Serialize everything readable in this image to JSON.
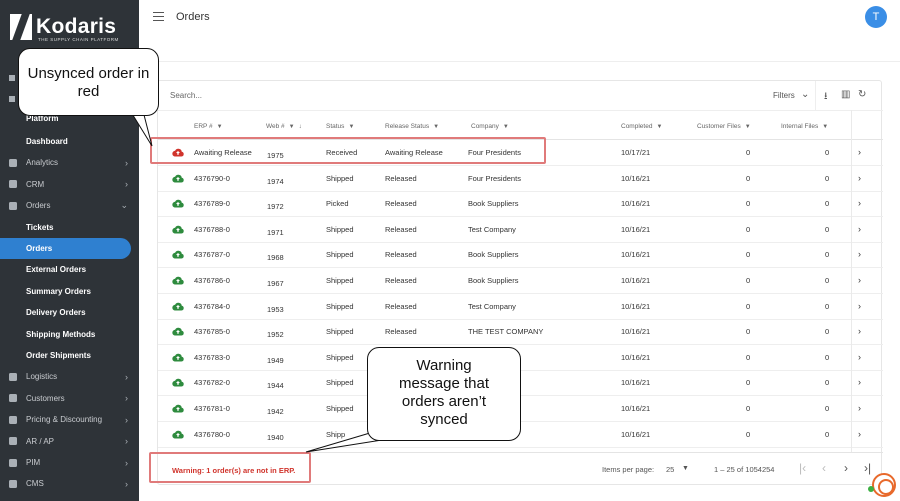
{
  "app": {
    "logo_text": "Kodaris",
    "logo_tagline": "THE SUPPLY CHAIN PLATFORM",
    "page_title": "Orders",
    "user_initial": "T"
  },
  "sidebar": {
    "partial_label": "Platform",
    "items": [
      {
        "label": "Dashboard",
        "type": "sub"
      },
      {
        "label": "Analytics",
        "type": "main",
        "icon": "analytics-icon"
      },
      {
        "label": "CRM",
        "type": "main",
        "icon": "crm-icon"
      },
      {
        "label": "Orders",
        "type": "main",
        "icon": "orders-icon"
      },
      {
        "label": "Tickets",
        "type": "sub"
      },
      {
        "label": "Orders",
        "type": "sub",
        "active": true
      },
      {
        "label": "External Orders",
        "type": "sub"
      },
      {
        "label": "Summary Orders",
        "type": "sub"
      },
      {
        "label": "Delivery Orders",
        "type": "sub"
      },
      {
        "label": "Shipping Methods",
        "type": "sub"
      },
      {
        "label": "Order Shipments",
        "type": "sub"
      },
      {
        "label": "Logistics",
        "type": "main",
        "icon": "truck-icon"
      },
      {
        "label": "Customers",
        "type": "main",
        "icon": "customers-icon"
      },
      {
        "label": "Pricing & Discounting",
        "type": "main",
        "icon": "dollar-icon"
      },
      {
        "label": "AR / AP",
        "type": "main",
        "icon": "bank-icon"
      },
      {
        "label": "PIM",
        "type": "main",
        "icon": "tag-icon"
      },
      {
        "label": "CMS",
        "type": "main",
        "icon": "cms-icon"
      }
    ]
  },
  "toolbar": {
    "search_placeholder": "Search...",
    "filters_label": "Filters"
  },
  "table": {
    "columns": [
      "ERP #",
      "Web #",
      "Status",
      "Release Status",
      "Company",
      "Completed",
      "Customer Files",
      "Internal Files"
    ],
    "rows": [
      {
        "erp": "Awaiting Release",
        "web": "1975",
        "status": "Received",
        "release": "Awaiting Release",
        "company": "Four Presidents",
        "completed": "10/17/21",
        "customer_files": "0",
        "internal_files": "0",
        "synced": false
      },
      {
        "erp": "4376790-0",
        "web": "1974",
        "status": "Shipped",
        "release": "Released",
        "company": "Four Presidents",
        "completed": "10/16/21",
        "customer_files": "0",
        "internal_files": "0",
        "synced": true
      },
      {
        "erp": "4376789-0",
        "web": "1972",
        "status": "Picked",
        "release": "Released",
        "company": "Book Suppliers",
        "completed": "10/16/21",
        "customer_files": "0",
        "internal_files": "0",
        "synced": true
      },
      {
        "erp": "4376788-0",
        "web": "1971",
        "status": "Shipped",
        "release": "Released",
        "company": "Test Company",
        "completed": "10/16/21",
        "customer_files": "0",
        "internal_files": "0",
        "synced": true
      },
      {
        "erp": "4376787-0",
        "web": "1968",
        "status": "Shipped",
        "release": "Released",
        "company": "Book Suppliers",
        "completed": "10/16/21",
        "customer_files": "0",
        "internal_files": "0",
        "synced": true
      },
      {
        "erp": "4376786-0",
        "web": "1967",
        "status": "Shipped",
        "release": "Released",
        "company": "Book Suppliers",
        "completed": "10/16/21",
        "customer_files": "0",
        "internal_files": "0",
        "synced": true
      },
      {
        "erp": "4376784-0",
        "web": "1953",
        "status": "Shipped",
        "release": "Released",
        "company": "Test Company",
        "completed": "10/16/21",
        "customer_files": "0",
        "internal_files": "0",
        "synced": true
      },
      {
        "erp": "4376785-0",
        "web": "1952",
        "status": "Shipped",
        "release": "Released",
        "company": "THE TEST COMPANY",
        "completed": "10/16/21",
        "customer_files": "0",
        "internal_files": "0",
        "synced": true
      },
      {
        "erp": "4376783-0",
        "web": "1949",
        "status": "Shipped",
        "release": "",
        "company": "PANY",
        "completed": "10/16/21",
        "customer_files": "0",
        "internal_files": "0",
        "synced": true
      },
      {
        "erp": "4376782-0",
        "web": "1944",
        "status": "Shipped",
        "release": "",
        "company": "",
        "completed": "10/16/21",
        "customer_files": "0",
        "internal_files": "0",
        "synced": true
      },
      {
        "erp": "4376781-0",
        "web": "1942",
        "status": "Shipped",
        "release": "",
        "company": "",
        "completed": "10/16/21",
        "customer_files": "0",
        "internal_files": "0",
        "synced": true
      },
      {
        "erp": "4376780-0",
        "web": "1940",
        "status": "Shipp",
        "release": "",
        "company": "&",
        "completed": "10/16/21",
        "customer_files": "0",
        "internal_files": "0",
        "synced": true
      }
    ]
  },
  "footer": {
    "warning": "Warning: 1 order(s) are not in ERP.",
    "items_per_page_label": "Items per page:",
    "items_per_page_value": "25",
    "range": "1 – 25 of 1054254"
  },
  "annotations": {
    "unsynced_callout": "Unsynced order in red",
    "warning_callout": "Warning message that orders aren’t synced"
  },
  "colors": {
    "sidebar_bg": "#2e3338",
    "active_item": "#2f80d0",
    "synced_cloud": "#2e8b3e",
    "unsynced_cloud": "#d0342c",
    "warning_text": "#d0342c",
    "highlight_box": "#e07a7a"
  }
}
